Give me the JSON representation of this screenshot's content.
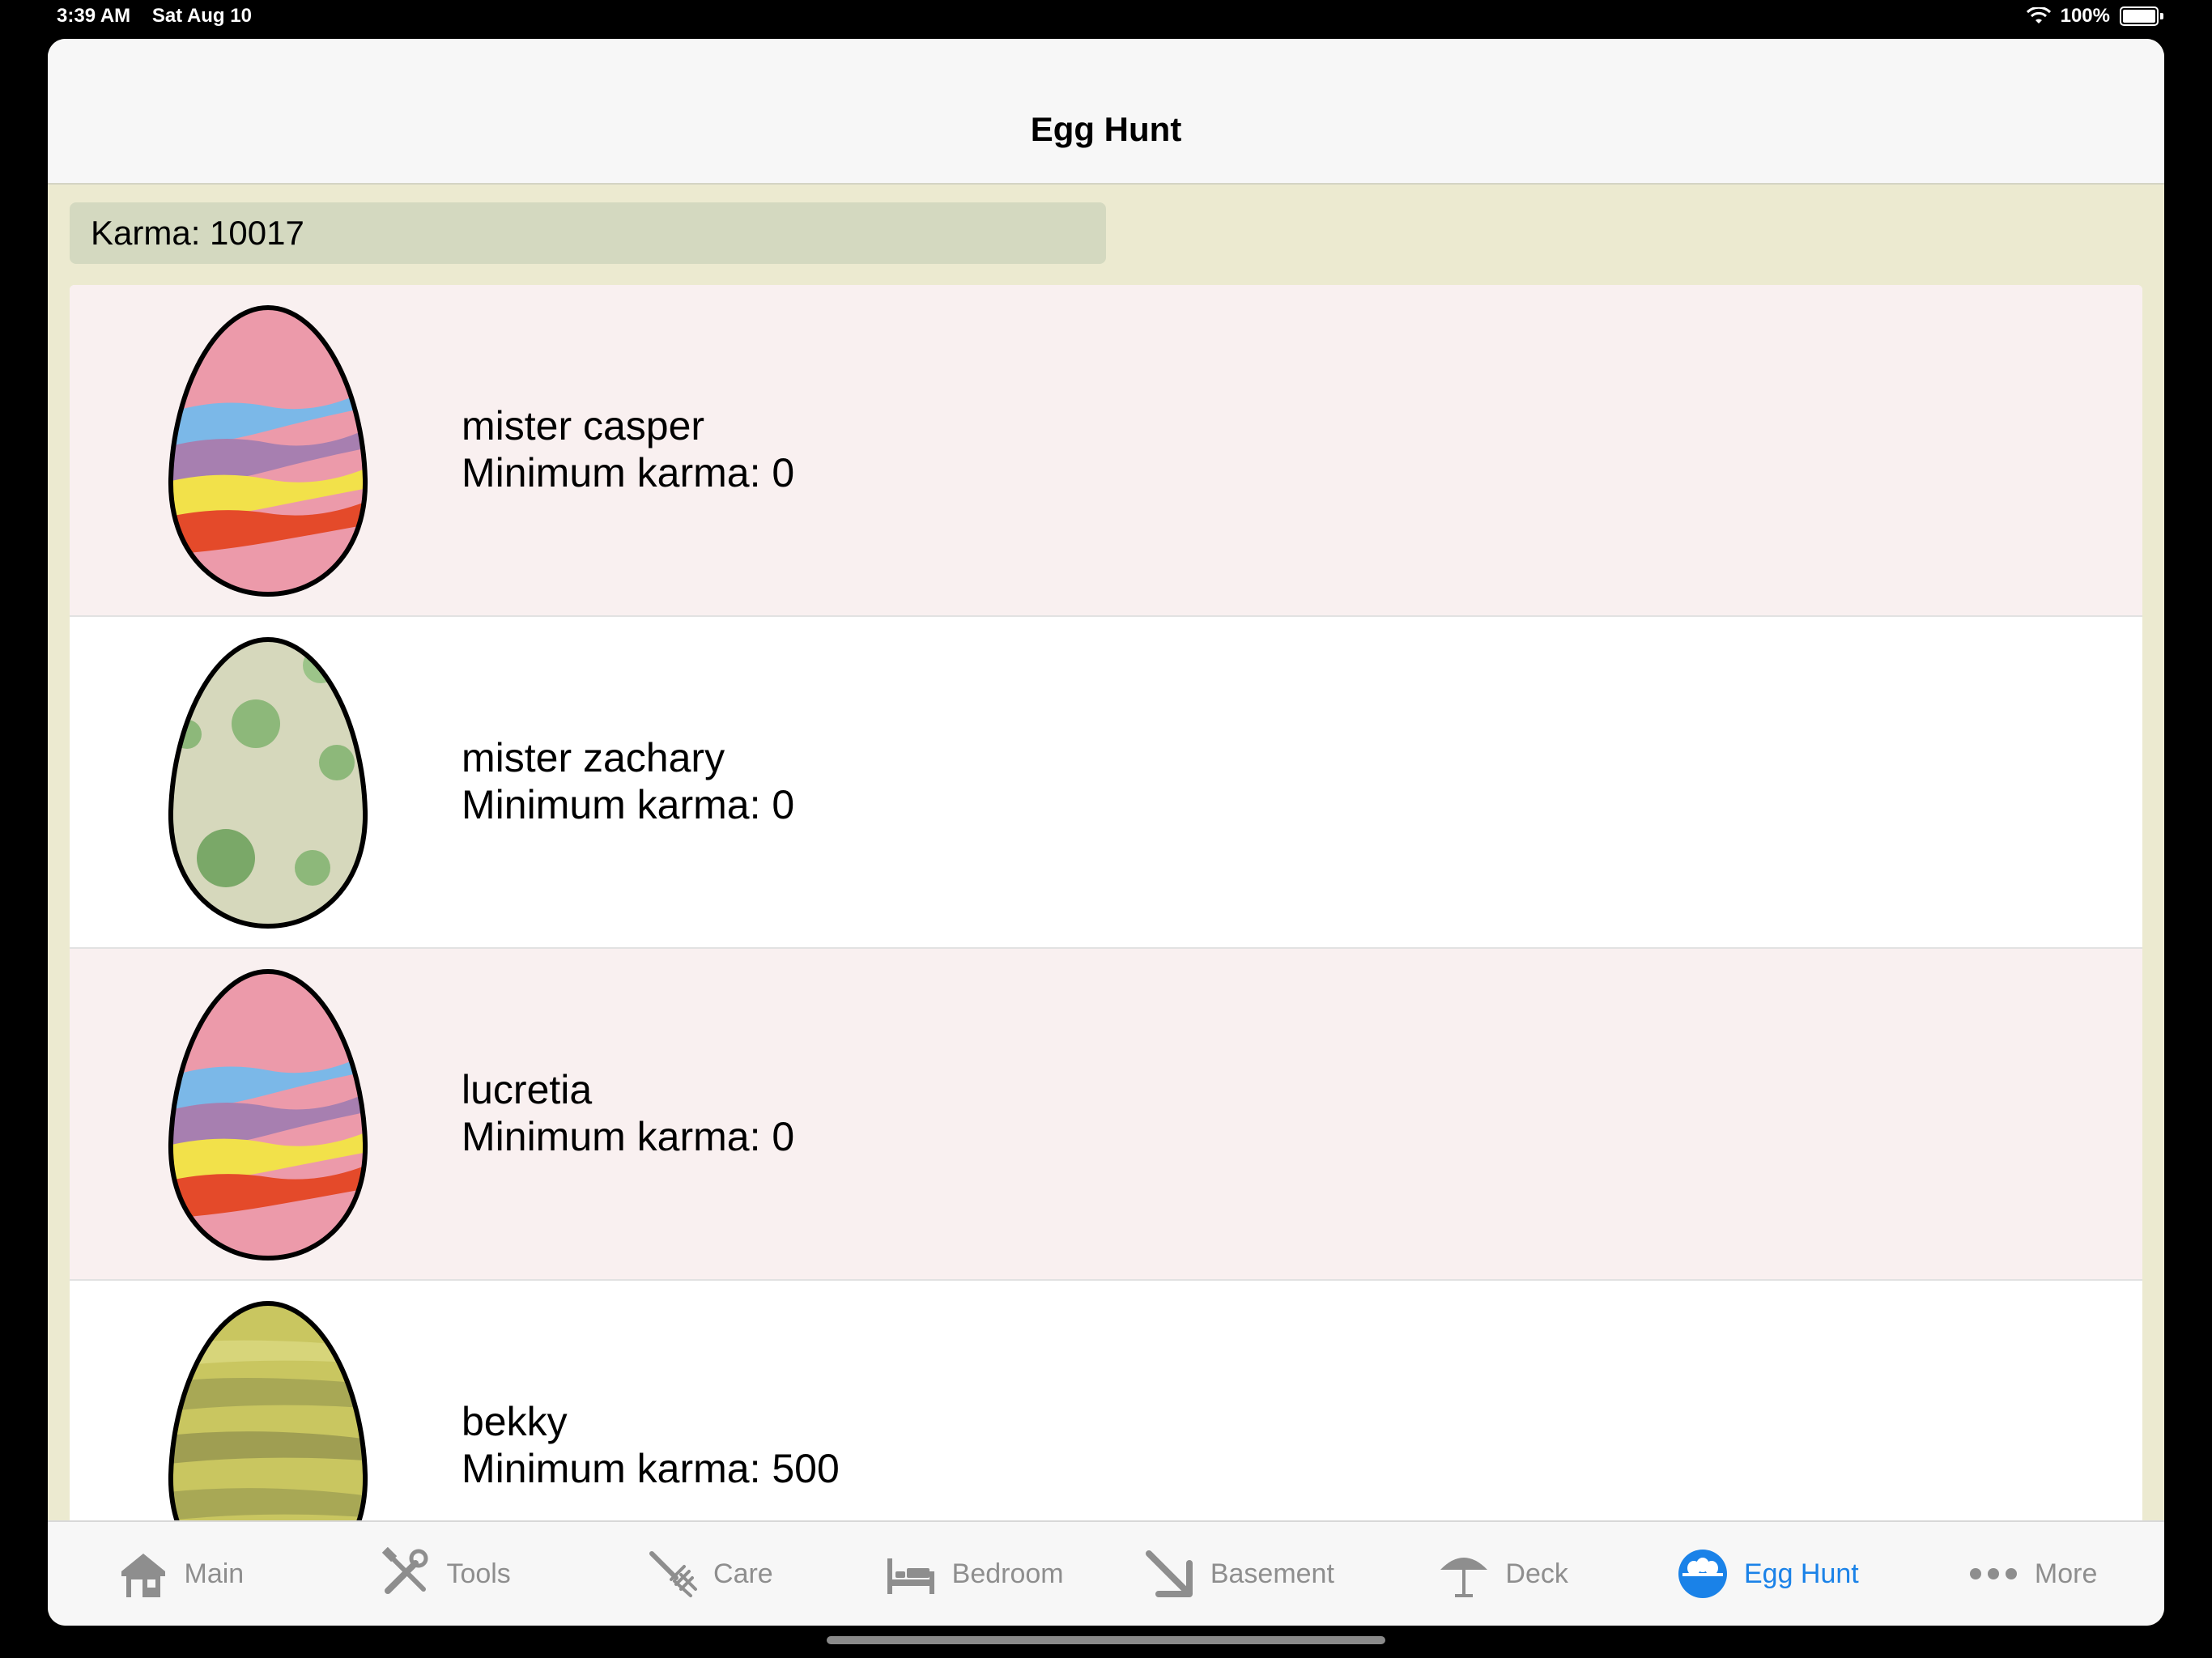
{
  "status": {
    "time": "3:39 AM",
    "date": "Sat Aug 10",
    "battery": "100%"
  },
  "nav": {
    "title": "Egg Hunt"
  },
  "karma": {
    "label": "Karma: 10017"
  },
  "eggs": [
    {
      "name": "mister casper",
      "min_karma": "Minimum karma: 0",
      "egg_style": "striped-pink-egg"
    },
    {
      "name": "mister zachary",
      "min_karma": "Minimum karma: 0",
      "egg_style": "spotted-green-egg"
    },
    {
      "name": "lucretia",
      "min_karma": "Minimum karma: 0",
      "egg_style": "striped-pink-egg"
    },
    {
      "name": "bekky",
      "min_karma": "Minimum karma: 500",
      "egg_style": "olive-striped-egg"
    }
  ],
  "tabs": [
    {
      "label": "Main",
      "icon": "house-icon"
    },
    {
      "label": "Tools",
      "icon": "tools-icon"
    },
    {
      "label": "Care",
      "icon": "pitchfork-icon"
    },
    {
      "label": "Bedroom",
      "icon": "bed-icon"
    },
    {
      "label": "Basement",
      "icon": "arrow-down-right-icon"
    },
    {
      "label": "Deck",
      "icon": "umbrella-icon"
    },
    {
      "label": "Egg Hunt",
      "icon": "egg-basket-icon",
      "active": true
    },
    {
      "label": "More",
      "icon": "ellipsis-icon"
    }
  ],
  "colors": {
    "accent": "#1a82e8",
    "inactive": "#8e8e8e",
    "background": "#ecead0",
    "row_tint": "#f9f0f0"
  }
}
